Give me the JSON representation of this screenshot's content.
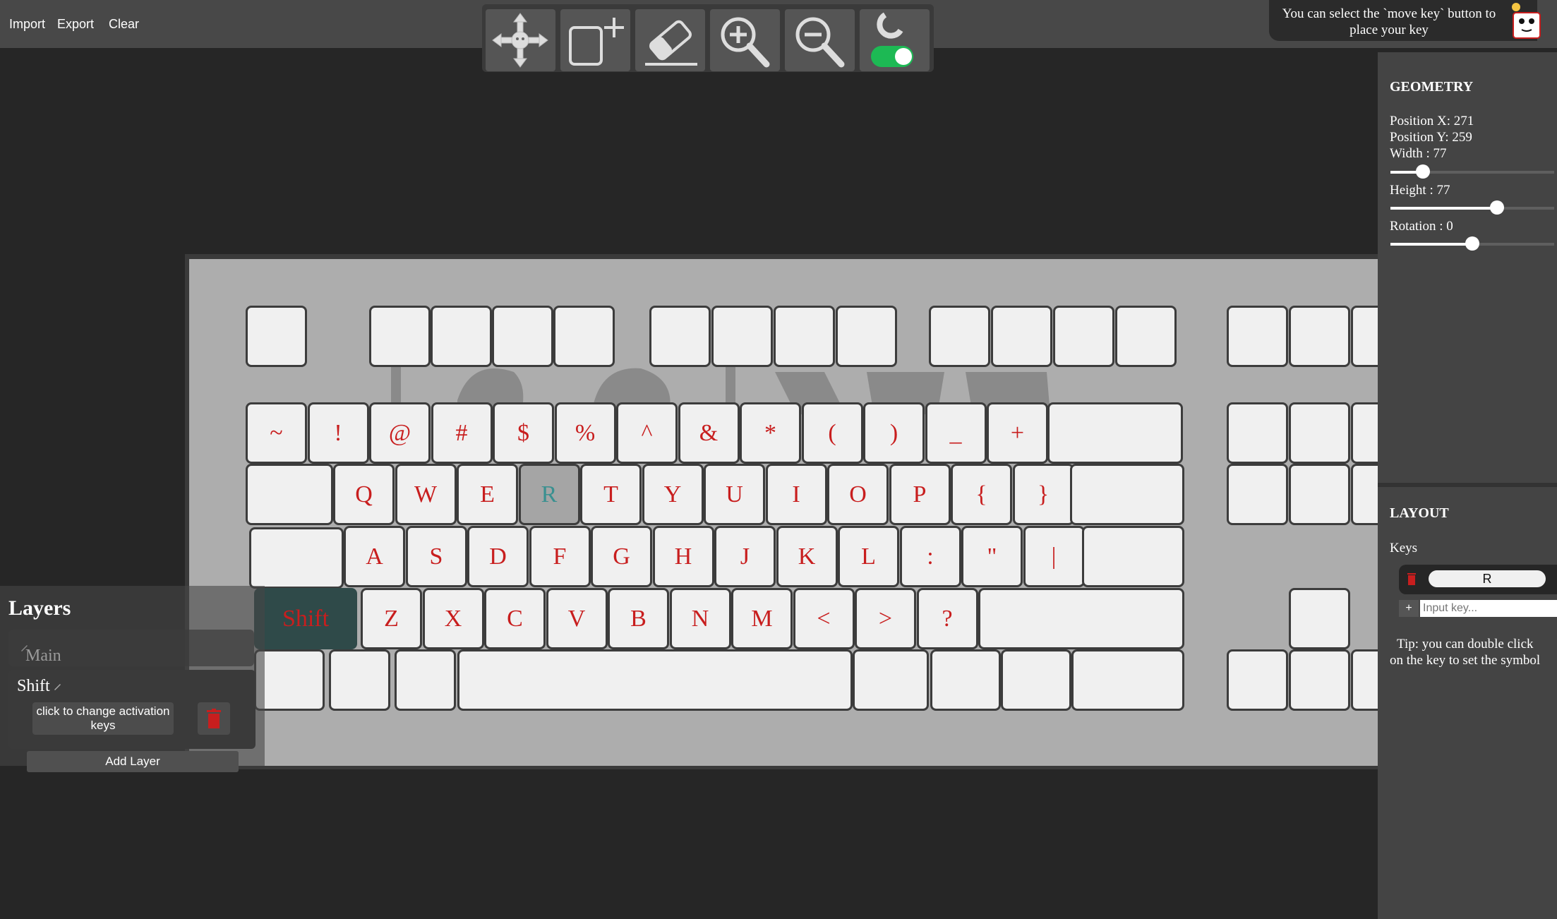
{
  "menu": {
    "import": "Import",
    "export": "Export",
    "clear": "Clear"
  },
  "toolbar": {
    "tools": [
      "move-key-icon",
      "add-key-icon",
      "eraser-icon",
      "zoom-in-icon",
      "zoom-out-icon",
      "magnet-toggle-icon"
    ],
    "magnet_enabled": true,
    "toggle_color": "#1db954"
  },
  "tip": {
    "text": "You can select the `move key` button to place your key"
  },
  "geometry": {
    "title": "GEOMETRY",
    "position_x": "Position X: 271",
    "position_y": "Position Y: 259",
    "width_label": "Width : 77",
    "width_value": 0.2,
    "height_label": "Height : 77",
    "height_value": 0.65,
    "rotation_label": "Rotation : 0",
    "rotation_value": 0.5
  },
  "layout": {
    "title": "LAYOUT",
    "keys_label": "Keys",
    "keys": [
      "R"
    ],
    "add_label": "+",
    "input_placeholder": "Input key...",
    "tip": "Tip: you can double click on the key to set the symbol"
  },
  "layers": {
    "title": "Layers",
    "items": [
      {
        "name": "Main"
      },
      {
        "name": "Shift",
        "activation_label": "click to change activation keys"
      }
    ],
    "add_label": "Add Layer"
  },
  "keyboard": {
    "key_text_color": "#c81e1e",
    "rows": [
      [
        "~",
        "!",
        "@",
        "#",
        "$",
        "%",
        "^",
        "&",
        "*",
        "(",
        ")",
        "_",
        "+"
      ],
      [
        "Q",
        "W",
        "E",
        "R",
        "T",
        "Y",
        "U",
        "I",
        "O",
        "P",
        "{",
        "}"
      ],
      [
        "A",
        "S",
        "D",
        "F",
        "G",
        "H",
        "J",
        "K",
        "L",
        ":",
        "\"",
        "|"
      ],
      [
        "Shift",
        "Z",
        "X",
        "C",
        "V",
        "B",
        "N",
        "M",
        "<",
        ">",
        "?"
      ]
    ],
    "selected_key": "R"
  }
}
